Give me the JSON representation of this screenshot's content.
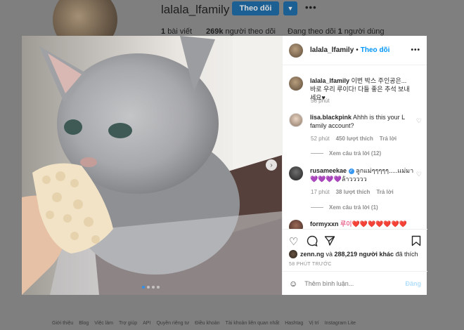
{
  "profile": {
    "username": "lalala_lfamily",
    "follow_label": "Theo dõi",
    "dropdown_icon": "chevron-down-icon",
    "more_icon": "•••",
    "stats": [
      {
        "count": "1",
        "label": "bài viết"
      },
      {
        "count": "269k",
        "label": "người theo dõi"
      },
      {
        "prefix": "Đang theo dõi",
        "count": "1",
        "label": "người dùng"
      }
    ]
  },
  "post": {
    "header": {
      "username": "lalala_lfamily",
      "separator": "•",
      "follow_label": "Theo dõi",
      "more_icon": "•••"
    },
    "next_icon": "›",
    "caption": {
      "username": "lalala_lfamily",
      "text": "이번 박스 주인공은... 바로 우리 루이다! 다들 좋은 추석 보내세요♥",
      "time": "58 phút"
    },
    "comments": [
      {
        "username": "lisa.blackpink",
        "text": "Ahhh is this your L family account?",
        "time": "52 phút",
        "likes": "450 lượt thích",
        "reply_label": "Trả lời",
        "view_replies": "Xem câu trả lời (12)"
      },
      {
        "username": "rusameekae",
        "verified": true,
        "text": "ลูกแม่ๆๆๆๆๆ.....แม่มา💜💜💜💜ล้าววววว",
        "time": "17 phút",
        "likes": "38 lượt thích",
        "reply_label": "Trả lời",
        "view_replies": "Xem câu trả lời (1)"
      },
      {
        "username": "formyxxn",
        "text": "루이❤️❤️❤️❤️❤️❤️❤️❤️❤️"
      }
    ],
    "liked_by": {
      "user": "zenn.ng",
      "middle": "và",
      "others": "288,219 người khác",
      "suffix": "đã thích"
    },
    "time_ago": "58 PHÚT TRƯỚC",
    "comment_placeholder": "Thêm bình luận...",
    "post_label": "Đăng"
  },
  "footer": [
    "Giới thiệu",
    "Blog",
    "Việc làm",
    "Trợ giúp",
    "API",
    "Quyền riêng tư",
    "Điều khoản",
    "Tài khoản liên quan nhất",
    "Hashtag",
    "Vị trí",
    "Instagram Lite"
  ],
  "colors": {
    "accent": "#0095f6",
    "backdrop": "#7f7f7f",
    "follow_bg": "#1c5f93"
  }
}
